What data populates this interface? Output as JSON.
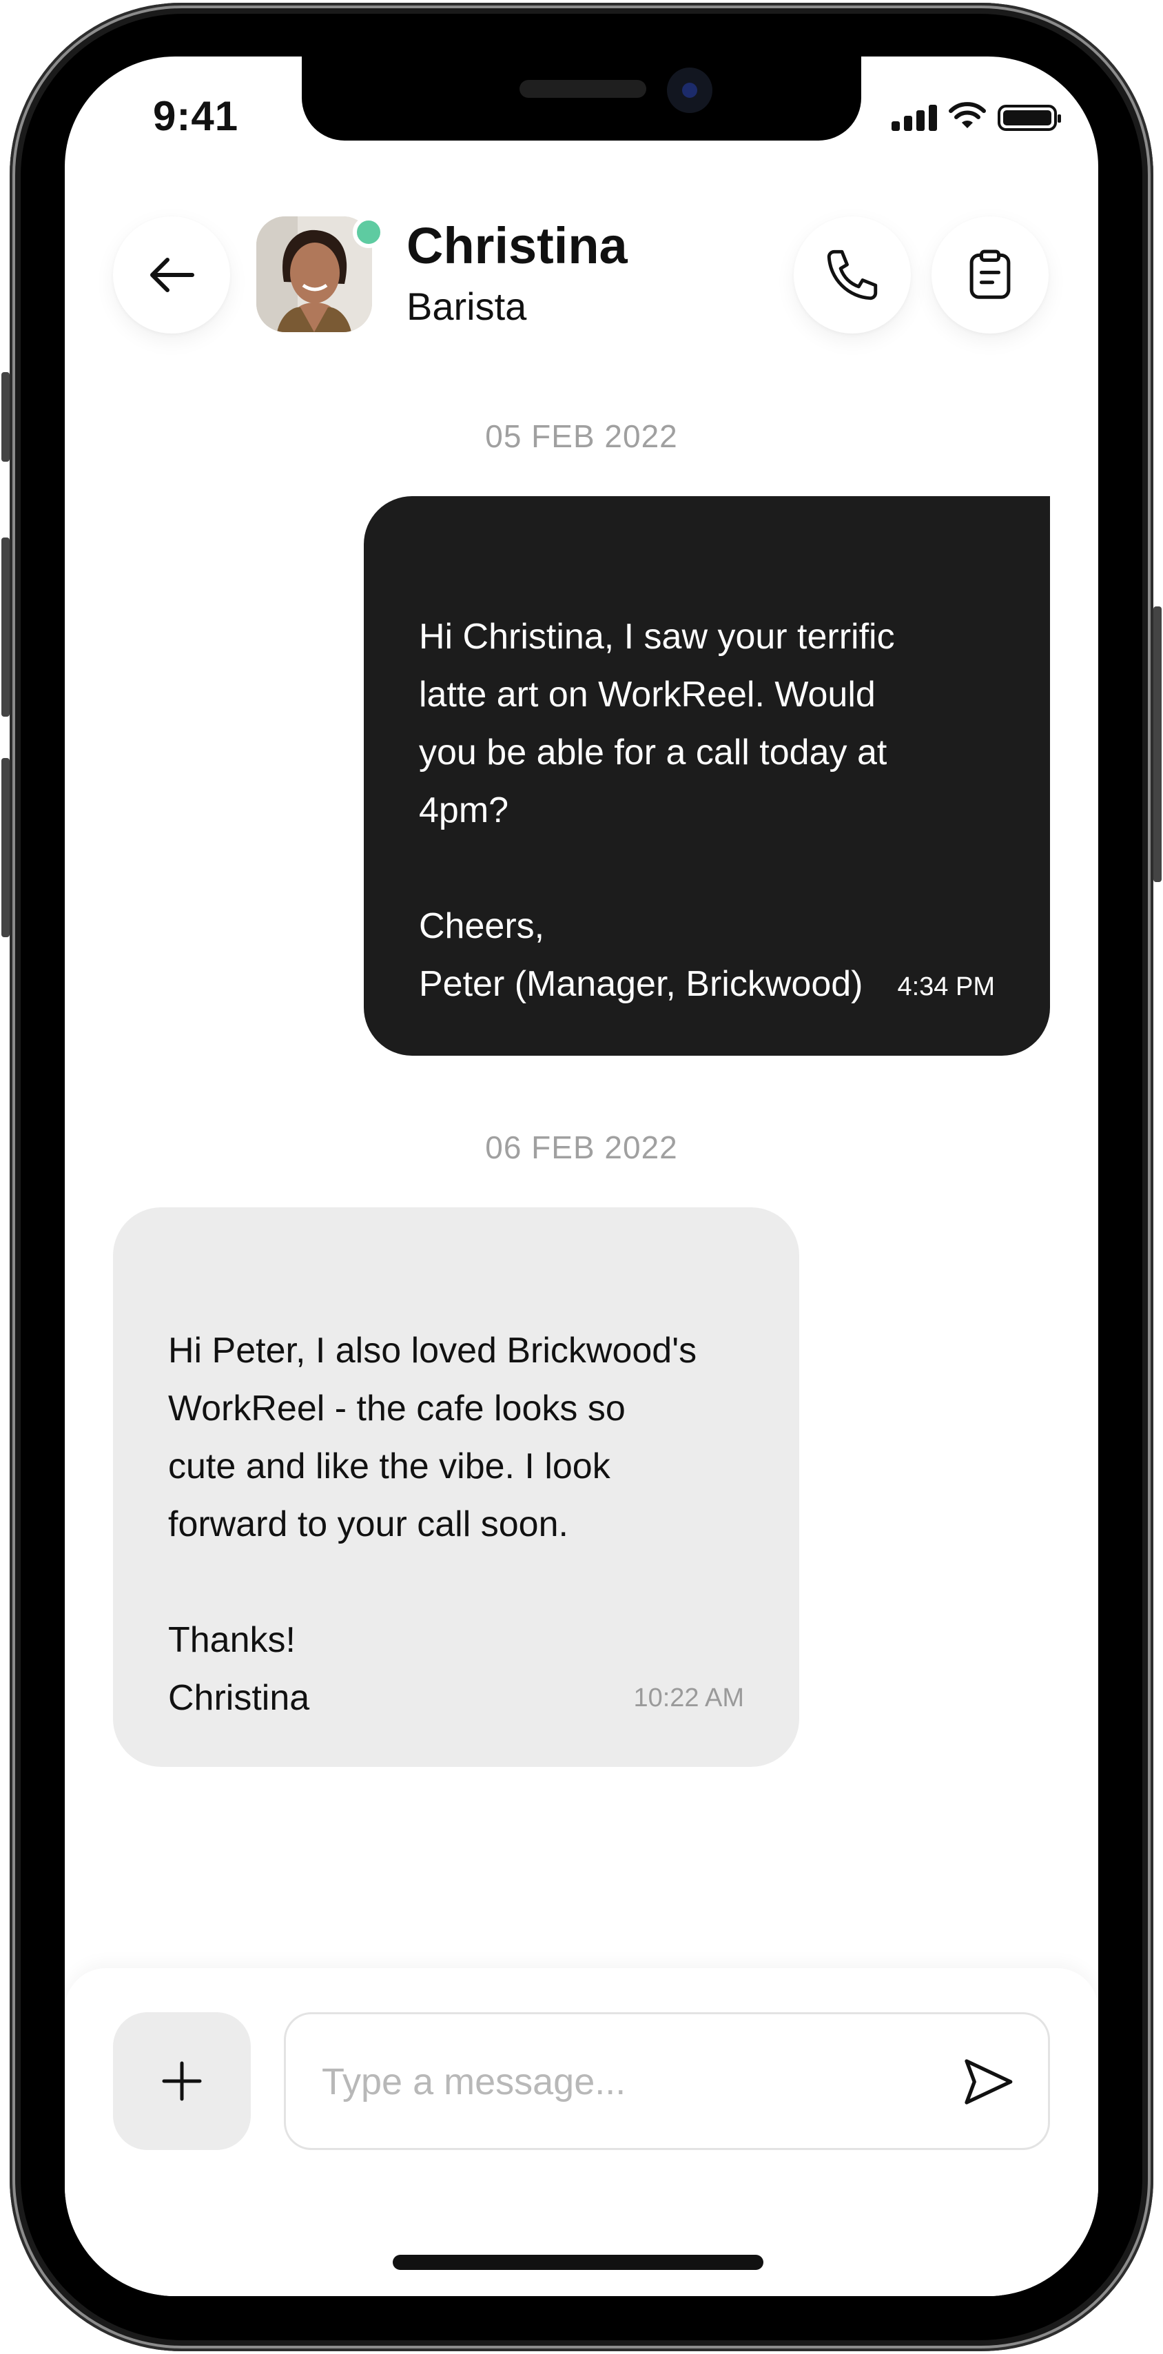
{
  "status_bar": {
    "time": "9:41"
  },
  "header": {
    "contact_name": "Christina",
    "contact_role": "Barista",
    "online_color": "#5ecba1"
  },
  "conversation": {
    "dates": [
      "05 FEB 2022",
      "06 FEB 2022"
    ],
    "messages": [
      {
        "direction": "outgoing",
        "text": "Hi Christina, I saw your terrific\nlatte art on WorkReel.  Would\nyou be able for a call today at\n4pm?\n\nCheers,\nPeter (Manager, Brickwood)",
        "time": "4:34 PM"
      },
      {
        "direction": "incoming",
        "text": "Hi Peter, I also loved Brickwood's\nWorkReel - the cafe looks so\ncute and like the vibe.  I look\nforward to your call soon.\n\nThanks!\nChristina",
        "time": "10:22 AM"
      }
    ]
  },
  "composer": {
    "placeholder": "Type a message...",
    "value": ""
  },
  "colors": {
    "outgoing_bubble": "#1c1c1c",
    "incoming_bubble": "#ececec",
    "date_text": "#a0a0a0"
  },
  "icons": {
    "back": "arrow-left-icon",
    "call": "phone-icon",
    "notes": "clipboard-icon",
    "add": "plus-icon",
    "send": "send-icon"
  }
}
